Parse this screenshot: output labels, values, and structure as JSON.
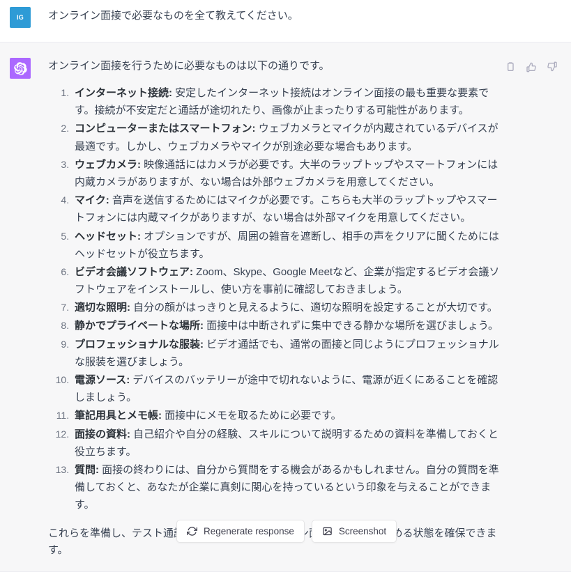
{
  "user_message": {
    "avatar_initials": "IG",
    "avatar_color": "#2e9bd6",
    "text": "オンライン面接で必要なものを全て教えてください。"
  },
  "assistant_message": {
    "avatar_color": "#ab68ff",
    "avatar_icon": "openai-logo-icon",
    "intro": "オンライン面接を行うために必要なものは以下の通りです。",
    "items": [
      {
        "term": "インターネット接続:",
        "body": " 安定したインターネット接続はオンライン面接の最も重要な要素です。接続が不安定だと通話が途切れたり、画像が止まったりする可能性があります。"
      },
      {
        "term": "コンピューターまたはスマートフォン:",
        "body": " ウェブカメラとマイクが内蔵されているデバイスが最適です。しかし、ウェブカメラやマイクが別途必要な場合もあります。"
      },
      {
        "term": "ウェブカメラ:",
        "body": " 映像通話にはカメラが必要です。大半のラップトップやスマートフォンには内蔵カメラがありますが、ない場合は外部ウェブカメラを用意してください。"
      },
      {
        "term": "マイク:",
        "body": " 音声を送信するためにはマイクが必要です。こちらも大半のラップトップやスマートフォンには内蔵マイクがありますが、ない場合は外部マイクを用意してください。"
      },
      {
        "term": "ヘッドセット:",
        "body": " オプションですが、周囲の雑音を遮断し、相手の声をクリアに聞くためにはヘッドセットが役立ちます。"
      },
      {
        "term": "ビデオ会議ソフトウェア:",
        "body": " Zoom、Skype、Google Meetなど、企業が指定するビデオ会議ソフトウェアをインストールし、使い方を事前に確認しておきましょう。"
      },
      {
        "term": "適切な照明:",
        "body": " 自分の顔がはっきりと見えるように、適切な照明を設定することが大切です。"
      },
      {
        "term": "静かでプライベートな場所:",
        "body": " 面接中は中断されずに集中できる静かな場所を選びましょう。"
      },
      {
        "term": "プロフェッショナルな服装:",
        "body": " ビデオ通話でも、通常の面接と同じようにプロフェッショナルな服装を選びましょう。"
      },
      {
        "term": "電源ソース:",
        "body": " デバイスのバッテリーが途中で切れないように、電源が近くにあることを確認しましょう。"
      },
      {
        "term": "筆記用具とメモ帳:",
        "body": " 面接中にメモを取るために必要です。"
      },
      {
        "term": "面接の資料:",
        "body": " 自己紹介や自分の経験、スキルについて説明するための資料を準備しておくと役立ちます。"
      },
      {
        "term": "質問:",
        "body": " 面接の終わりには、自分から質問をする機会があるかもしれません。自分の質問を準備しておくと、あなたが企業に真剣に関心を持っているという印象を与えることができます。"
      }
    ],
    "closing": "これらを準備し、テスト通話を行うことで、オンライン面接に安心して臨める状態を確保できます。",
    "actions": [
      {
        "name": "copy-icon",
        "label": "Copy"
      },
      {
        "name": "thumbs-up-icon",
        "label": "Good response"
      },
      {
        "name": "thumbs-down-icon",
        "label": "Bad response"
      }
    ]
  },
  "floating_buttons": [
    {
      "icon": "refresh-icon",
      "label": "Regenerate response"
    },
    {
      "icon": "image-icon",
      "label": "Screenshot"
    }
  ]
}
